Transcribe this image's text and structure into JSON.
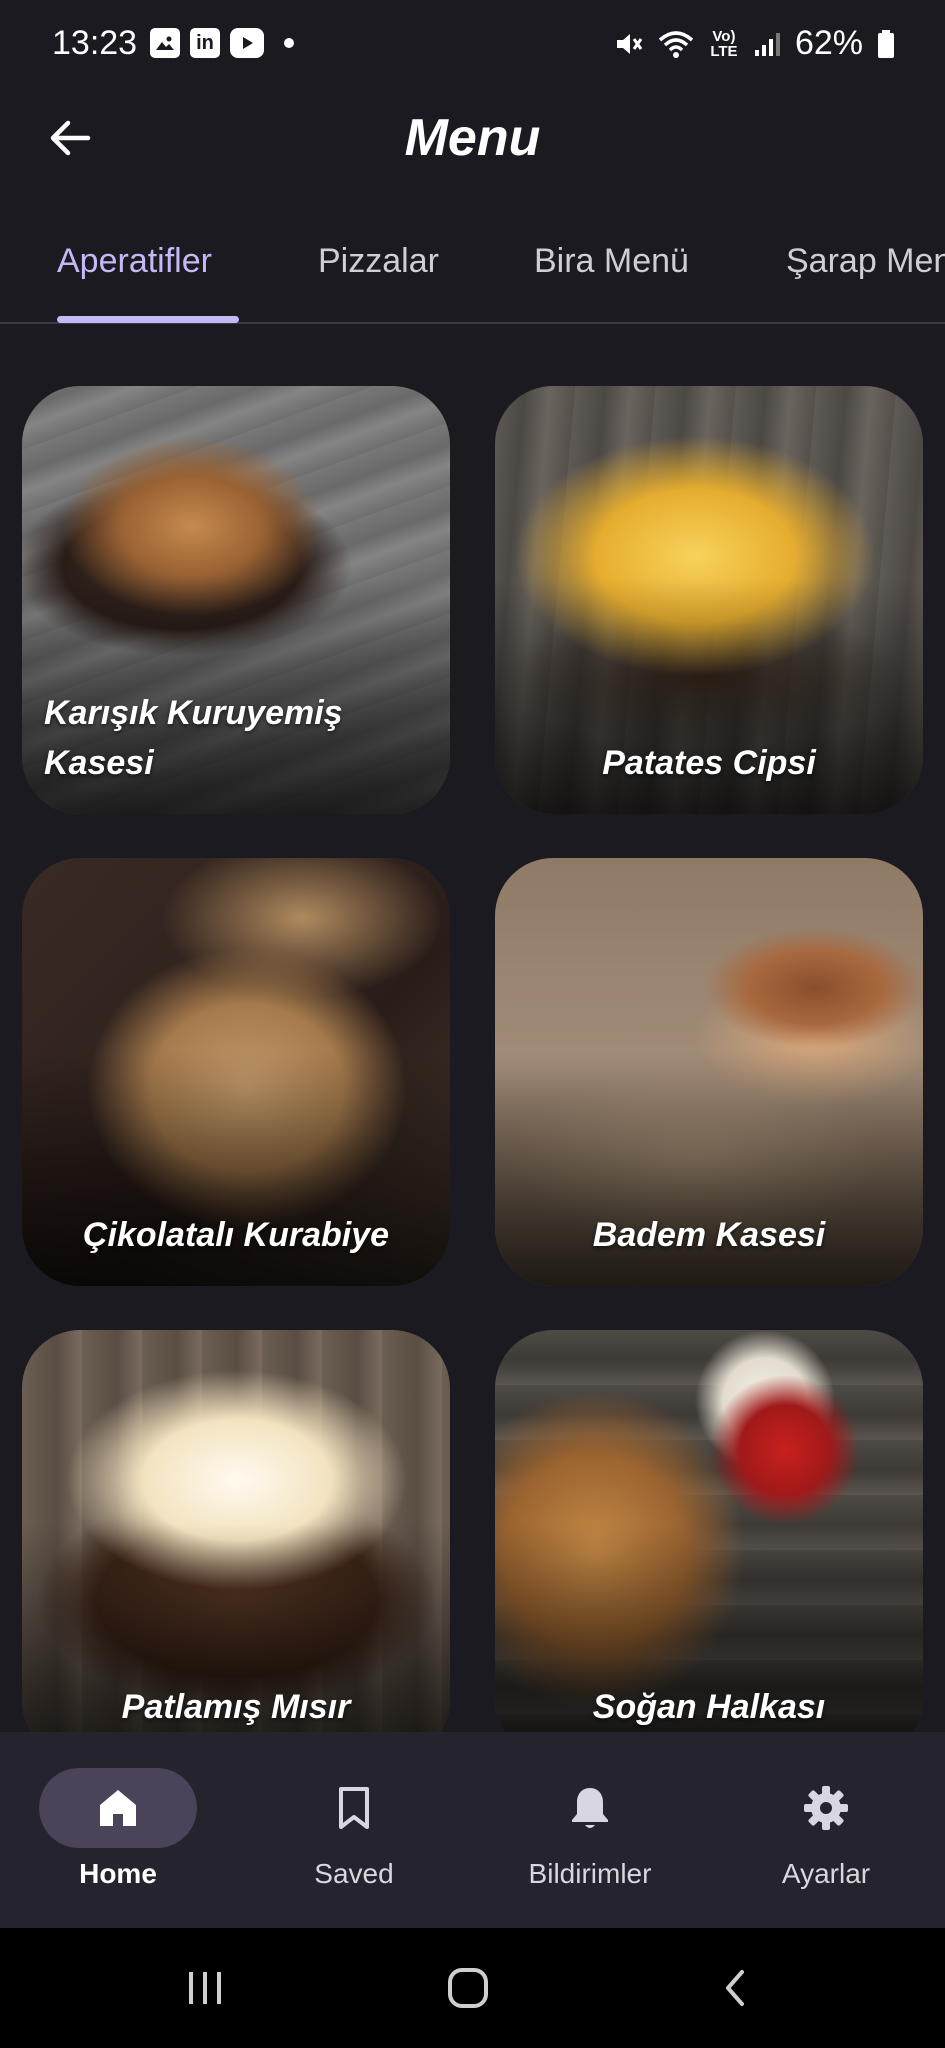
{
  "status_bar": {
    "time": "13:23",
    "left_icons": [
      "gallery-icon",
      "linkedin-icon",
      "youtube-icon",
      "dot-icon"
    ],
    "right_icons": [
      "mute-icon",
      "wifi-icon",
      "volte-icon",
      "signal-icon",
      "battery-icon"
    ],
    "volte_label": "Vo) LTE",
    "battery": "62%"
  },
  "app_bar": {
    "title": "Menu",
    "back_icon": "arrow-left-icon"
  },
  "tabs": [
    {
      "label": "Aperatifler",
      "active": true
    },
    {
      "label": "Pizzalar",
      "active": false
    },
    {
      "label": "Bira Menü",
      "active": false
    },
    {
      "label": "Şarap Menü",
      "active": false
    }
  ],
  "items": [
    {
      "label": "Karışık Kuruyemiş Kasesi",
      "image": "mixed-nuts-photo"
    },
    {
      "label": "Patates Cipsi",
      "image": "potato-chips-photo"
    },
    {
      "label": "Çikolatalı Kurabiye",
      "image": "chocolate-cookie-photo"
    },
    {
      "label": "Badem Kasesi",
      "image": "almond-bowl-photo"
    },
    {
      "label": "Patlamış Mısır",
      "image": "popcorn-photo"
    },
    {
      "label": "Soğan Halkası",
      "image": "onion-rings-photo"
    }
  ],
  "bottom_nav": [
    {
      "label": "Home",
      "icon": "home-icon",
      "active": true
    },
    {
      "label": "Saved",
      "icon": "bookmark-icon",
      "active": false
    },
    {
      "label": "Bildirimler",
      "icon": "bell-icon",
      "active": false
    },
    {
      "label": "Ayarlar",
      "icon": "gear-icon",
      "active": false
    }
  ],
  "system_nav": [
    "recents-icon",
    "home-circle-icon",
    "back-chevron-icon"
  ],
  "colors": {
    "background": "#1b1a20",
    "accent": "#c7b7f4",
    "nav_background": "#25232b",
    "nav_pill": "#4a4359"
  }
}
